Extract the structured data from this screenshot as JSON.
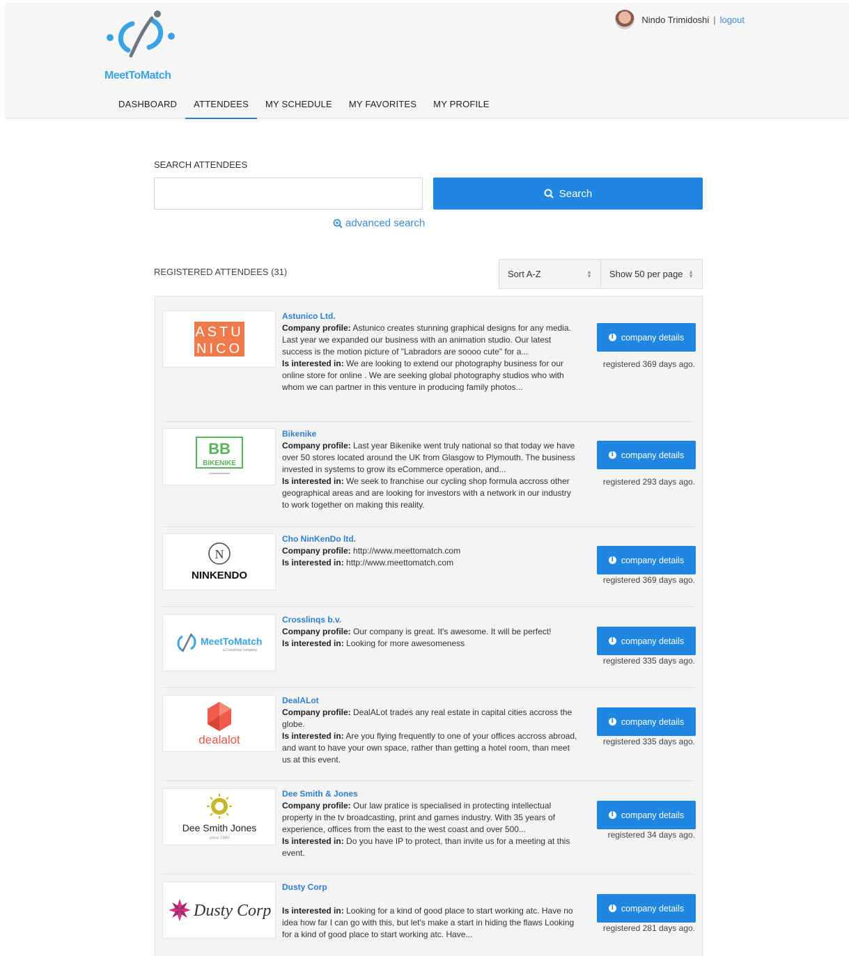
{
  "brand": {
    "name": "MeetToMatch"
  },
  "user": {
    "name": "Nindo Trimidoshi",
    "separator": "|",
    "logout": "logout"
  },
  "nav": [
    "DASHBOARD",
    "ATTENDEES",
    "MY SCHEDULE",
    "MY FAVORITES",
    "MY PROFILE"
  ],
  "search": {
    "label": "SEARCH ATTENDEES",
    "value": "",
    "button": "Search",
    "advanced": "advanced search"
  },
  "list_header": {
    "label": "REGISTERED ATTENDEES (31)",
    "sort": "Sort A-Z",
    "per_page": "Show 50 per page"
  },
  "attendees": [
    {
      "name": "Astunico Ltd.",
      "profile_label": "Company profile:",
      "profile": "Astunico creates stunning graphical designs for any media. Last year we expanded our business with an animation studio. Our latest success is the motion picture of \"Labradors are soooo cute\" for a...",
      "interest_label": "Is interested in:",
      "interest": "We are looking to extend our photography business for our online store for online . We are seeking global photography studios who with whom we can partner in this venture in producing family photos...",
      "button": "company details",
      "registered": "registered 369 days ago.",
      "logo_text": [
        "ASTU",
        "NICO"
      ]
    },
    {
      "name": "Bikenike",
      "profile_label": "Company profile:",
      "profile": "Last year Bikenike went truly national so that today we have over 50 stores located around the UK from Glasgow to Plymouth. The business invested in systems to grow its eCommerce operation, and...",
      "interest_label": "Is interested in:",
      "interest": "We seek to franchise our cycling shop formula accross other geographical areas and are looking for investors with a network in our industry to work together on making this reality.",
      "button": "company details",
      "registered": "registered 293 days ago.",
      "logo_text": [
        "BB",
        "BIKENIKE"
      ]
    },
    {
      "name": "Cho NinKenDo ltd.",
      "profile_label": "Company profile:",
      "profile": "http://www.meettomatch.com",
      "interest_label": "Is interested in:",
      "interest": "http://www.meettomatch.com",
      "button": "company details",
      "registered": "registered 369 days ago.",
      "logo_text": [
        "N",
        "NINKENDO"
      ]
    },
    {
      "name": "Crosslinqs b.v.",
      "profile_label": "Company profile:",
      "profile": "Our company is great. It's awesome. It will be perfect!",
      "interest_label": "Is interested in:",
      "interest": "Looking for more awesomeness",
      "button": "company details",
      "registered": "registered 335 days ago.",
      "logo_text": [
        "MeetToMatch",
        "a Crosslinqs company"
      ]
    },
    {
      "name": "DealALot",
      "profile_label": "Company profile:",
      "profile": "DealALot trades any real estate in capital cities accross the globe.",
      "interest_label": "Is interested in:",
      "interest": "Are you flying frequently to one of your offices accross abroad, and want to have your own space, rather than getting a hotel room, than meet us at this event.",
      "button": "company details",
      "registered": "registered 335 days ago.",
      "logo_text": [
        "dealalot"
      ]
    },
    {
      "name": "Dee Smith & Jones",
      "profile_label": "Company profile:",
      "profile": "Our law pratice is specialised in protecting intellectual property in the tv broadcasting, print and games industry. With 35 years of experience, offices from the east to the west coast and over 500...",
      "interest_label": "Is interested in:",
      "interest": "Do you have IP to protect, than invite us for a meeting at this event.",
      "button": "company details",
      "registered": "registered 34 days ago.",
      "logo_text": [
        "Dee Smith Jones",
        "since 1980"
      ]
    },
    {
      "name": "Dusty Corp",
      "profile_label": "",
      "profile": "",
      "interest_label": "Is interested in:",
      "interest": "Looking for a kind of good place to start working atc. Have no idea how far I can go with this, but let's make a start in hiding the flaws Looking for a kind of good place to start working atc. Have...",
      "button": "company details",
      "registered": "registered 281 days ago.",
      "logo_text": [
        "Dusty Corp"
      ]
    }
  ],
  "colors": {
    "accent": "#1f86e2",
    "link": "#2f7fd1",
    "brand": "#3aa3e3"
  }
}
